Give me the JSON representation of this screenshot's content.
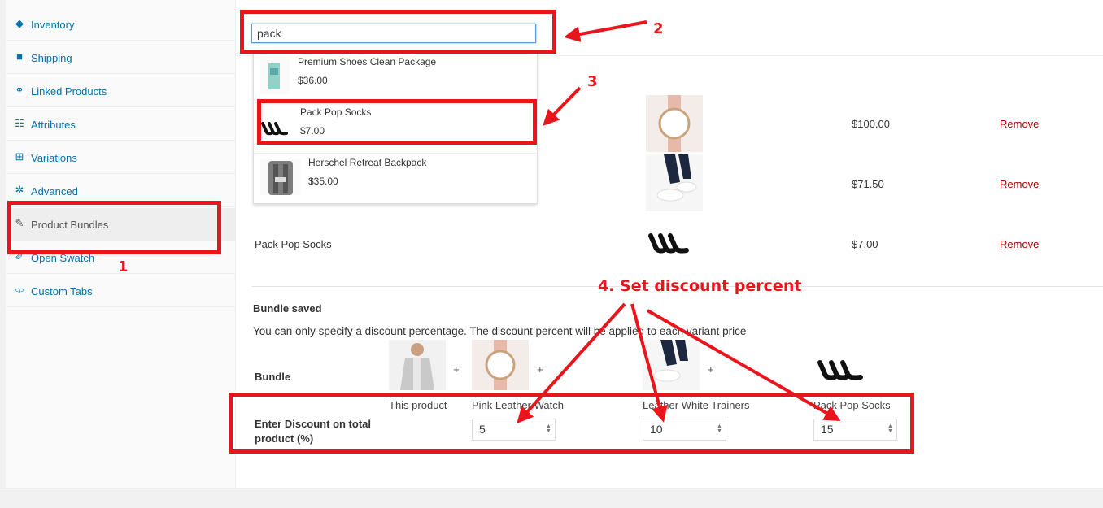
{
  "sidebar": {
    "items": [
      {
        "label": "Inventory",
        "icon": "tag-icon"
      },
      {
        "label": "Shipping",
        "icon": "truck-icon"
      },
      {
        "label": "Linked Products",
        "icon": "link-icon"
      },
      {
        "label": "Attributes",
        "icon": "list-icon"
      },
      {
        "label": "Variations",
        "icon": "grid-icon"
      },
      {
        "label": "Advanced",
        "icon": "gear-icon"
      },
      {
        "label": "Product Bundles",
        "icon": "wrench-icon"
      },
      {
        "label": "Open Swatch",
        "icon": "brush-icon"
      },
      {
        "label": "Custom Tabs",
        "icon": "code-icon"
      }
    ],
    "active": "Product Bundles"
  },
  "search": {
    "value": "pack"
  },
  "dropdown": {
    "items": [
      {
        "name": "Premium Shoes Clean Package",
        "price": "$36.00"
      },
      {
        "name": "Pack Pop Socks",
        "price": "$7.00"
      },
      {
        "name": "Herschel Retreat Backpack",
        "price": "$35.00"
      }
    ]
  },
  "bundle_rows": [
    {
      "name": "",
      "price": "$100.00",
      "remove": "Remove"
    },
    {
      "name": "",
      "price": "$71.50",
      "remove": "Remove"
    },
    {
      "name": "Pack Pop Socks",
      "price": "$7.00",
      "remove": "Remove"
    }
  ],
  "bundle_saved": {
    "heading": "Bundle saved",
    "note": "You can only specify a discount percentage. The discount percent will be applied to each variant price",
    "bundle_label": "Bundle",
    "discount_label_1": "Enter Discount on total",
    "discount_label_2": "product (%)",
    "plus": "+",
    "products": [
      {
        "name": "This product",
        "discount": null
      },
      {
        "name": "Pink Leather Watch",
        "discount": "5"
      },
      {
        "name": "Leather White Trainers",
        "discount": "10"
      },
      {
        "name": "Pack Pop Socks",
        "discount": "15"
      }
    ]
  },
  "annotations": {
    "n1": "1",
    "n2": "2",
    "n3": "3",
    "n4": "4. Set discount percent",
    "color": "#e8161c"
  },
  "colors": {
    "link": "#0073aa",
    "remove": "#aa0000",
    "focus": "#5b9dd9"
  }
}
